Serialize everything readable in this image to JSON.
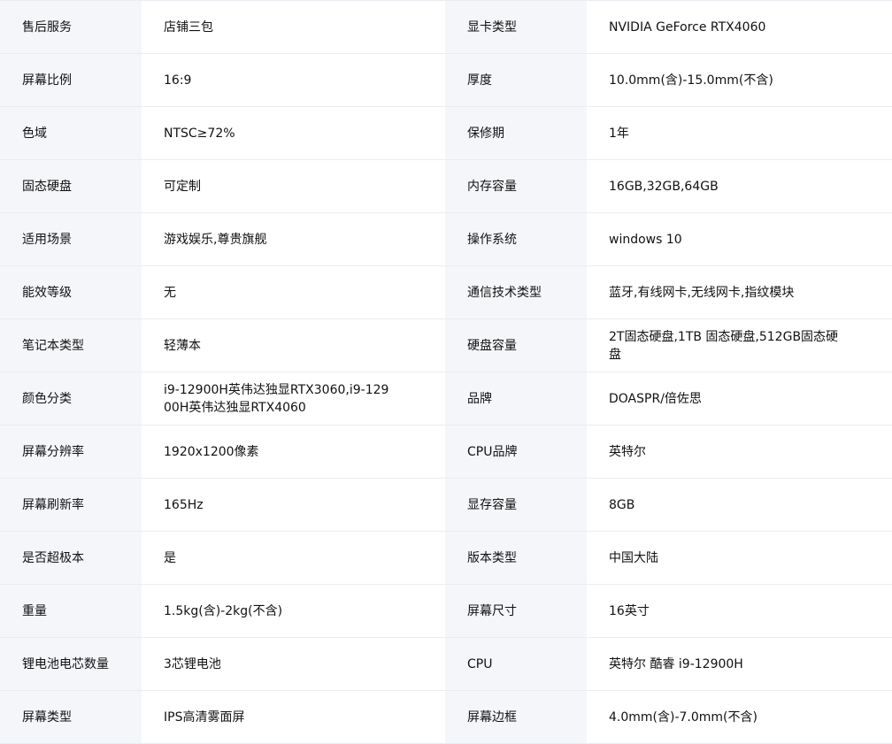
{
  "specs": {
    "rows": [
      {
        "left_label": "售后服务",
        "left_value": "店铺三包",
        "right_label": "显卡类型",
        "right_value": "NVIDIA GeForce RTX4060"
      },
      {
        "left_label": "屏幕比例",
        "left_value": "16:9",
        "right_label": "厚度",
        "right_value": "10.0mm(含)-15.0mm(不含)"
      },
      {
        "left_label": "色域",
        "left_value": "NTSC≥72%",
        "right_label": "保修期",
        "right_value": "1年"
      },
      {
        "left_label": "固态硬盘",
        "left_value": "可定制",
        "right_label": "内存容量",
        "right_value": "16GB,32GB,64GB"
      },
      {
        "left_label": "适用场景",
        "left_value": "游戏娱乐,尊贵旗舰",
        "right_label": "操作系统",
        "right_value": "windows 10"
      },
      {
        "left_label": "能效等级",
        "left_value": "无",
        "right_label": "通信技术类型",
        "right_value": "蓝牙,有线网卡,无线网卡,指纹模块"
      },
      {
        "left_label": "笔记本类型",
        "left_value": "轻薄本",
        "right_label": "硬盘容量",
        "right_value": "2T固态硬盘,1TB 固态硬盘,512GB固态硬盘"
      },
      {
        "left_label": "颜色分类",
        "left_value": "i9-12900H英伟达独显RTX3060,i9-12900H英伟达独显RTX4060",
        "right_label": "品牌",
        "right_value": "DOASPR/倍佐思"
      },
      {
        "left_label": "屏幕分辨率",
        "left_value": "1920x1200像素",
        "right_label": "CPU品牌",
        "right_value": "英特尔"
      },
      {
        "left_label": "屏幕刷新率",
        "left_value": "165Hz",
        "right_label": "显存容量",
        "right_value": "8GB"
      },
      {
        "left_label": "是否超极本",
        "left_value": "是",
        "right_label": "版本类型",
        "right_value": "中国大陆"
      },
      {
        "left_label": "重量",
        "left_value": "1.5kg(含)-2kg(不含)",
        "right_label": "屏幕尺寸",
        "right_value": "16英寸"
      },
      {
        "left_label": "锂电池电芯数量",
        "left_value": "3芯锂电池",
        "right_label": "CPU",
        "right_value": "英特尔 酷睿 i9-12900H"
      },
      {
        "left_label": "屏幕类型",
        "left_value": "IPS高清雾面屏",
        "right_label": "屏幕边框",
        "right_value": "4.0mm(含)-7.0mm(不含)"
      }
    ]
  }
}
